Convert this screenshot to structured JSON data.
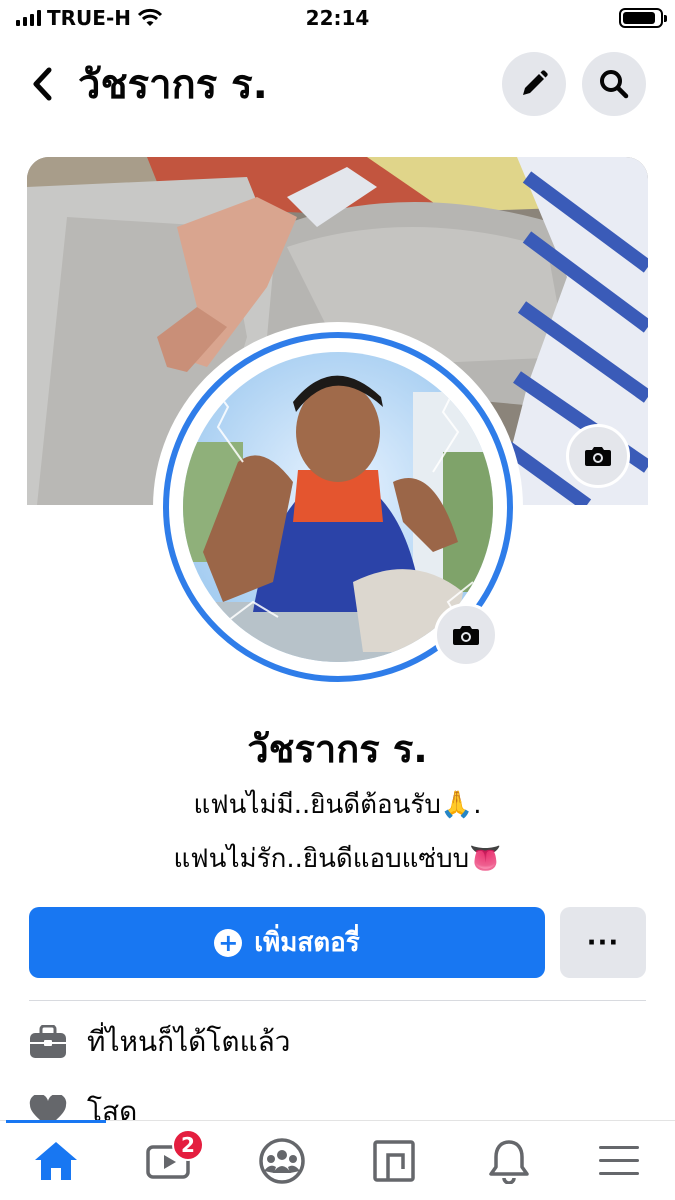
{
  "status_bar": {
    "carrier": "TRUE-H",
    "time": "22:14",
    "battery_level": 0.9
  },
  "header": {
    "title": "วัชรากร ร.",
    "icons": [
      "chevron-left-icon",
      "pencil-icon",
      "search-icon"
    ]
  },
  "profile": {
    "name": "วัชรากร ร.",
    "bio_line1": "แฟนไม่มี..ยินดีต้อนรับ🙏.",
    "bio_line2": "แฟนไม่รัก..ยินดีแอบแซ่บบ👅"
  },
  "actions": {
    "add_story_label": "เพิ่มสตอรี่",
    "more_label": "···"
  },
  "info": {
    "workplace": "ที่ไหนก็ได้โตแล้ว",
    "relationship": "โสด"
  },
  "tab_bar": {
    "tabs": [
      "home",
      "watch",
      "groups",
      "marketplace",
      "notifications",
      "menu"
    ],
    "active": "home",
    "watch_badge": "2"
  },
  "colors": {
    "accent": "#1877f2",
    "badge": "#e41e3f",
    "button_gray": "#e4e6eb",
    "avatar_ring": "#2f7de9"
  }
}
